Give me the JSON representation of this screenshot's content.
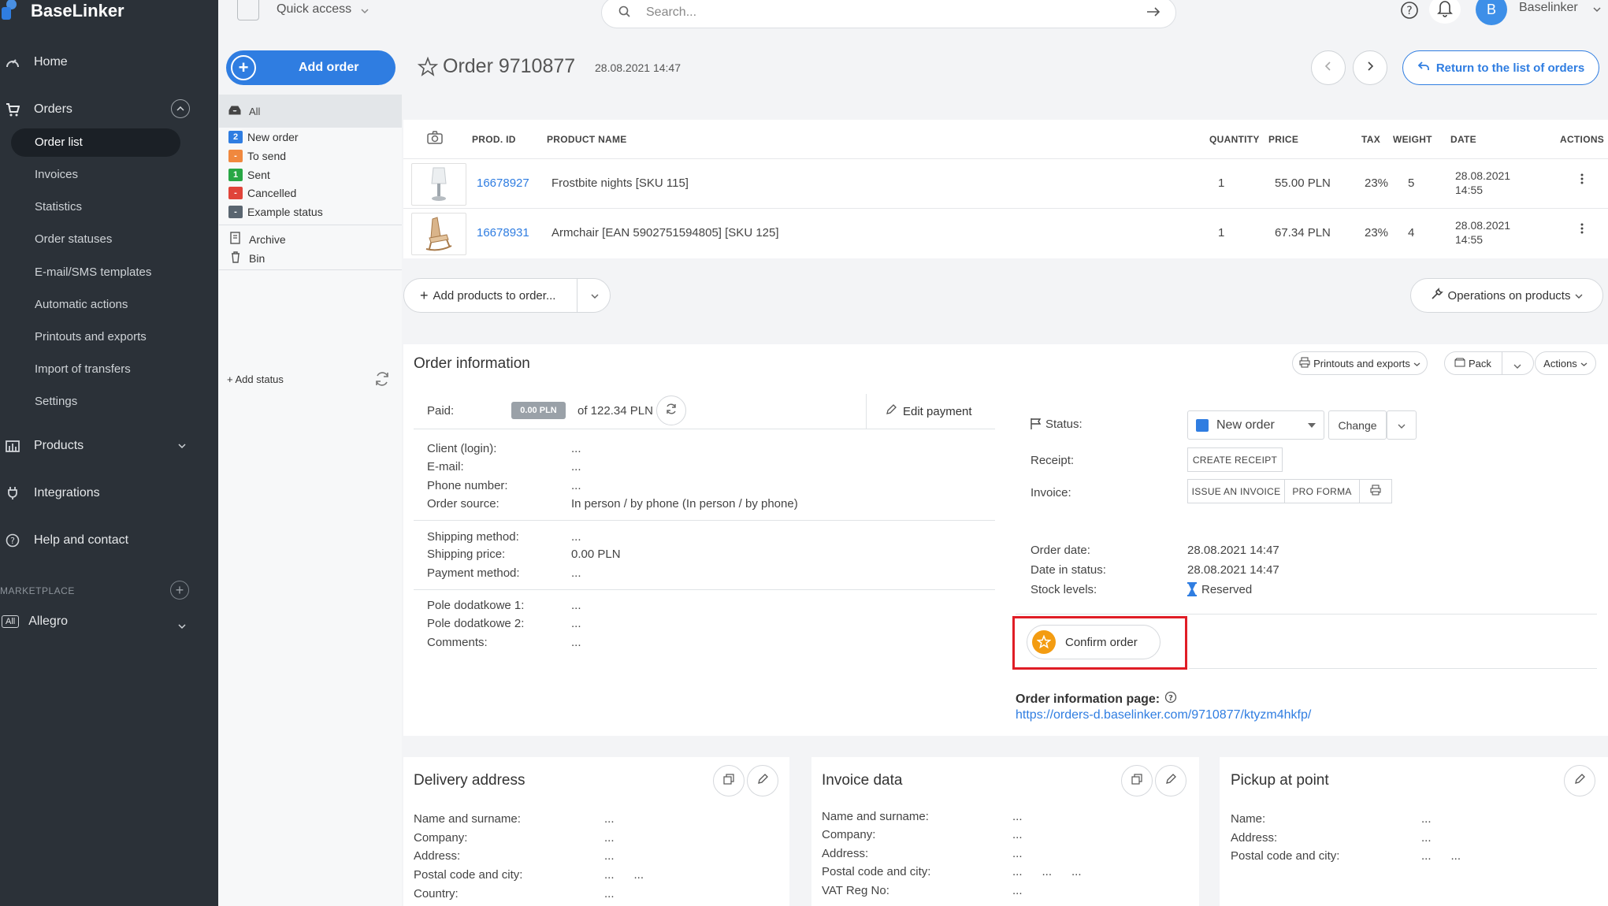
{
  "brand": {
    "name": "BaseLinker"
  },
  "sidebar": {
    "items": [
      {
        "label": "Home",
        "icon": "home-icon"
      },
      {
        "label": "Orders",
        "icon": "cart-icon"
      },
      {
        "label": "Products",
        "icon": "products-icon"
      },
      {
        "label": "Integrations",
        "icon": "plug-icon"
      },
      {
        "label": "Help and contact",
        "icon": "help-icon"
      }
    ],
    "orders_sub": [
      "Order list",
      "Invoices",
      "Statistics",
      "Order statuses",
      "E-mail/SMS templates",
      "Automatic actions",
      "Printouts and exports",
      "Import of transfers",
      "Settings"
    ],
    "marketplace_label": "MARKETPLACE",
    "allegro": {
      "tag": "All",
      "label": "Allegro"
    }
  },
  "topbar": {
    "quick_access": "Quick access",
    "search_placeholder": "Search...",
    "user_initial": "B",
    "user_name": "Baselinker"
  },
  "header": {
    "add_order": "Add order",
    "order_title": "Order 9710877",
    "order_date": "28.08.2021 14:47",
    "return_label": "Return to the list of orders"
  },
  "statuses": {
    "all": "All",
    "list": [
      {
        "badge": "2",
        "label": "New order",
        "color": "#2f7de1"
      },
      {
        "badge": "-",
        "label": "To send",
        "color": "#f0883e"
      },
      {
        "badge": "1",
        "label": "Sent",
        "color": "#28a745"
      },
      {
        "badge": "-",
        "label": "Cancelled",
        "color": "#e0443a"
      },
      {
        "badge": "-",
        "label": "Example status",
        "color": "#5a6570"
      }
    ],
    "archive": "Archive",
    "bin": "Bin",
    "add_status": "+ Add status"
  },
  "products_table": {
    "headers": {
      "prod_id": "PROD. ID",
      "product_name": "PRODUCT NAME",
      "quantity": "QUANTITY",
      "price": "PRICE",
      "tax": "TAX",
      "weight": "WEIGHT",
      "date": "DATE",
      "actions": "ACTIONS"
    },
    "rows": [
      {
        "id": "16678927",
        "name": "Frostbite nights [SKU 115]",
        "qty": "1",
        "price": "55.00 PLN",
        "tax": "23%",
        "weight": "5",
        "date1": "28.08.2021",
        "date2": "14:55"
      },
      {
        "id": "16678931",
        "name": "Armchair [EAN 5902751594805] [SKU 125]",
        "qty": "1",
        "price": "67.34 PLN",
        "tax": "23%",
        "weight": "4",
        "date1": "28.08.2021",
        "date2": "14:55"
      }
    ],
    "add_products": "Add products to order...",
    "operations": "Operations on products"
  },
  "order_info": {
    "title": "Order information",
    "printouts": "Printouts and exports",
    "pack": "Pack",
    "actions": "Actions",
    "paid_label": "Paid:",
    "paid_badge": "0.00 PLN",
    "paid_of": "of 122.34 PLN",
    "edit_payment": "Edit payment",
    "client_fields": [
      {
        "label": "Client (login):",
        "value": "..."
      },
      {
        "label": "E-mail:",
        "value": "..."
      },
      {
        "label": "Phone number:",
        "value": "..."
      },
      {
        "label": "Order source:",
        "value": "In person / by phone (In person / by phone)"
      }
    ],
    "shipping_fields": [
      {
        "label": "Shipping method:",
        "value": "..."
      },
      {
        "label": "Shipping price:",
        "value": "0.00 PLN"
      },
      {
        "label": "Payment method:",
        "value": "..."
      }
    ],
    "extra_fields": [
      {
        "label": "Pole dodatkowe 1:",
        "value": "..."
      },
      {
        "label": "Pole dodatkowe 2:",
        "value": "..."
      },
      {
        "label": "Comments:",
        "value": "..."
      }
    ],
    "status_label": "Status:",
    "status_value": "New order",
    "change": "Change",
    "receipt_label": "Receipt:",
    "create_receipt": "CREATE RECEIPT",
    "invoice_label": "Invoice:",
    "issue_invoice": "ISSUE AN INVOICE",
    "pro_forma": "PRO FORMA",
    "dates": [
      {
        "label": "Order date:",
        "value": "28.08.2021 14:47"
      },
      {
        "label": "Date in status:",
        "value": "28.08.2021 14:47"
      },
      {
        "label": "Stock levels:",
        "value": "Reserved"
      }
    ],
    "confirm_order": "Confirm order",
    "info_page_label": "Order information page:",
    "info_page_url": "https://orders-d.baselinker.com/9710877/ktyzm4hkfp/"
  },
  "delivery": {
    "title": "Delivery address",
    "fields": [
      {
        "label": "Name and surname:",
        "value": "..."
      },
      {
        "label": "Company:",
        "value": "..."
      },
      {
        "label": "Address:",
        "value": "..."
      },
      {
        "label": "Postal code and city:",
        "value": "...      ..."
      },
      {
        "label": "Country:",
        "value": "..."
      }
    ]
  },
  "invoice_data": {
    "title": "Invoice data",
    "fields": [
      {
        "label": "Name and surname:",
        "value": "..."
      },
      {
        "label": "Company:",
        "value": "..."
      },
      {
        "label": "Address:",
        "value": "..."
      },
      {
        "label": "Postal code and city:",
        "value": "...      ...      ..."
      },
      {
        "label": "VAT Reg No:",
        "value": "..."
      }
    ]
  },
  "pickup": {
    "title": "Pickup at point",
    "fields": [
      {
        "label": "Name:",
        "value": "..."
      },
      {
        "label": "Address:",
        "value": "..."
      },
      {
        "label": "Postal code and city:",
        "value": "...      ..."
      }
    ]
  }
}
